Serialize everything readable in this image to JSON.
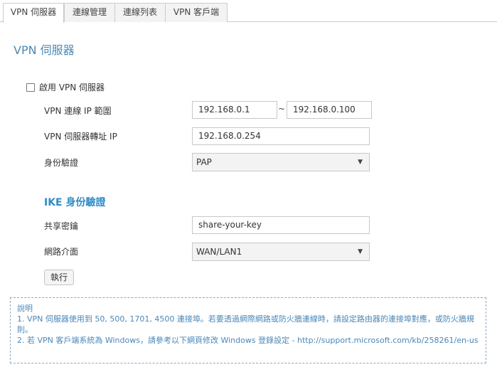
{
  "tabs": [
    {
      "label": "VPN 伺服器",
      "active": true
    },
    {
      "label": "連線管理",
      "active": false
    },
    {
      "label": "連線列表",
      "active": false
    },
    {
      "label": "VPN 客戶端",
      "active": false
    }
  ],
  "page_title": "VPN 伺服器",
  "enable_checkbox": {
    "label": "啟用 VPN 伺服器",
    "checked": false
  },
  "ip_range": {
    "label": "VPN 連線 IP 範圍",
    "start": "192.168.0.1",
    "separator": "~",
    "end": "192.168.0.100"
  },
  "forward_ip": {
    "label": "VPN 伺服器轉址 IP",
    "value": "192.168.0.254"
  },
  "auth": {
    "label": "身份驗證",
    "value": "PAP"
  },
  "ike_title": "IKE 身份驗證",
  "psk": {
    "label": "共享密鑰",
    "value": "share-your-key"
  },
  "interface": {
    "label": "網路介面",
    "value": "WAN/LAN1"
  },
  "execute_label": "執行",
  "notes": {
    "title": "說明",
    "line1": "1. VPN 伺服器使用到 50, 500, 1701, 4500 連接埠。若要透過網際網路或防火牆連線時，請設定路由器的連接埠對應，或防火牆規則。",
    "line2": "2. 若 VPN 客戶端系統為 Windows，請參考以下網頁修改 Windows 登錄設定 - http://support.microsoft.com/kb/258261/en-us"
  },
  "colors": {
    "accent": "#4a8ab2",
    "section": "#2e8cc6",
    "note_text": "#4a87b8",
    "border": "#cccccc"
  }
}
